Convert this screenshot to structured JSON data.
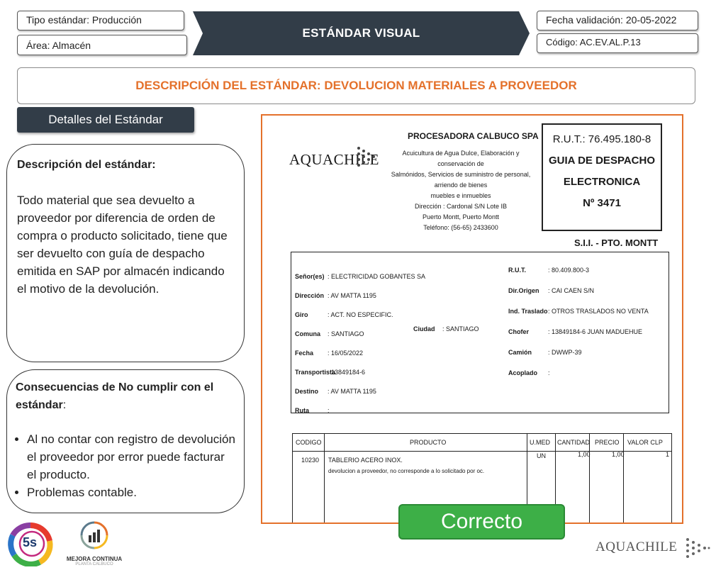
{
  "header": {
    "tipo_estandar": "Tipo estándar: Producción",
    "area": "Área: Almacén",
    "banner_title": "ESTÁNDAR VISUAL",
    "fecha_validacion": "Fecha validación: 20-05-2022",
    "codigo": "Código: AC.EV.AL.P.13"
  },
  "description_title": "DESCRIPCIÓN DEL ESTÁNDAR: DEVOLUCION MATERIALES A PROVEEDOR",
  "details_button": "Detalles del Estándar",
  "description_panel": {
    "heading": "Descripción del estándar:",
    "body": "Todo material que sea devuelto a proveedor por diferencia de orden de compra o producto solicitado, tiene que ser devuelto con guía de despacho emitida en SAP por almacén indicando el motivo de la devolución."
  },
  "consequences_panel": {
    "heading": "Consecuencias de No cumplir con el estándar",
    "heading_suffix": ":",
    "bullets": [
      "Al no contar con registro de devolución el proveedor por error puede facturar el producto.",
      " Problemas contable."
    ]
  },
  "document": {
    "logo_text": "AQUACHILE",
    "company": "PROCESADORA CALBUCO SPA",
    "company_lines": [
      "Acuicultura de Agua Dulce, Elaboración y conservación de",
      "Salmónidos, Servicios de suministro de personal, arriendo de bienes",
      "muebles e inmuebles",
      "Dirección : Cardonal S/N Lote IB",
      "Puerto Montt, Puerto Montt",
      "Teléfono: (56-65) 2433600"
    ],
    "rut_box": [
      "R.U.T.: 76.495.180-8",
      "GUIA DE DESPACHO",
      "ELECTRONICA",
      "Nº 3471"
    ],
    "sii": "S.I.I. - PTO. MONTT",
    "fields_left": [
      {
        "label": "Señor(es)",
        "value": ": ELECTRICIDAD GOBANTES SA"
      },
      {
        "label": "Dirección",
        "value": ": AV MATTA 1195"
      },
      {
        "label": "Giro",
        "value": ": ACT. NO ESPECIFIC."
      },
      {
        "label": "Comuna",
        "value": ": SANTIAGO"
      },
      {
        "label": "Fecha",
        "value": ": 16/05/2022"
      },
      {
        "label": "Transportista",
        "value": ": 13849184-6"
      },
      {
        "label": "Destino",
        "value": ": AV MATTA 1195"
      },
      {
        "label": "Ruta",
        "value": ":"
      }
    ],
    "ciudad": {
      "label": "Ciudad",
      "value": ": SANTIAGO"
    },
    "fields_right": [
      {
        "label": "R.U.T.",
        "value": ": 80.409.800-3"
      },
      {
        "label": "Dir.Origen",
        "value": ": CAI CAEN S/N"
      },
      {
        "label": "Ind. Traslado",
        "value": ": OTROS TRASLADOS NO VENTA"
      },
      {
        "label": "Chofer",
        "value": ": 13849184-6 JUAN MADUEHUE"
      },
      {
        "label": "Camión",
        "value": ": DWWP-39"
      },
      {
        "label": "Acoplado",
        "value": ":"
      }
    ],
    "table": {
      "headers": [
        "CODIGO",
        "PRODUCTO",
        "U.MED",
        "CANTIDAD",
        "PRECIO",
        "VALOR CLP"
      ],
      "row": {
        "codigo": "10230",
        "producto": "TABLERIO ACERO INOX.",
        "umed": "UN",
        "cantidad": "1,00",
        "precio": "1,00",
        "valor": "1"
      },
      "note": "devolucion a proveedor, no corresponde a lo solicitado por oc."
    }
  },
  "correcto_label": "Correcto",
  "footer": {
    "badge_5s": "5s",
    "mejora_line1": "MEJORA CONTINUA",
    "mejora_line2": "PLANTA CALBUCO",
    "aquachile_logo": "AQUACHILE"
  },
  "colors": {
    "accent_orange": "#e4712b",
    "dark_slate": "#323d48",
    "correct_green": "#3daf47"
  }
}
